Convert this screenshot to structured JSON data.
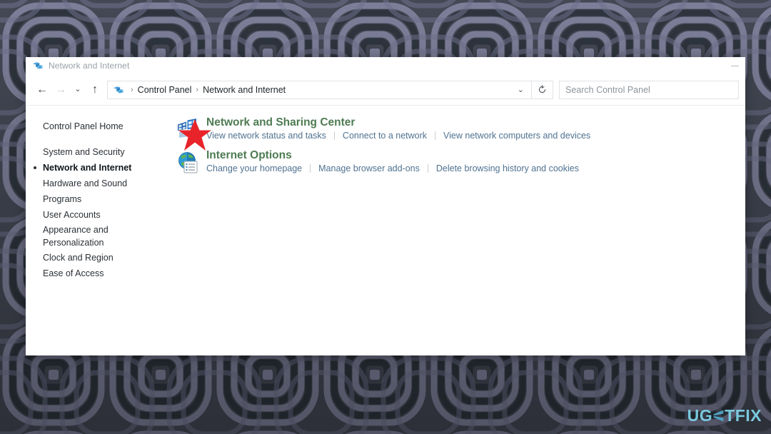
{
  "desktop": {
    "wallpaper_description": "concentric rounded-square maze pattern",
    "wallpaper_colors": {
      "base": "#46505c",
      "dark": "#2f3a42",
      "light": "#9a9ab8",
      "mid": "#6f7490"
    }
  },
  "window": {
    "title": "Network and Internet",
    "title_icon": "network-folder-icon",
    "controls": {
      "minimize_label": "—"
    }
  },
  "toolbar": {
    "back_label": "←",
    "forward_label": "→",
    "recent_label": "⌄",
    "up_label": "↑",
    "refresh_label": "↻",
    "address_icon": "network-folder-icon",
    "breadcrumbs": [
      "Control Panel",
      "Network and Internet"
    ],
    "breadcrumb_separator": "›",
    "dropdown_label": "⌄"
  },
  "search": {
    "placeholder": "Search Control Panel",
    "value": ""
  },
  "sidebar": {
    "items": [
      {
        "label": "Control Panel Home",
        "current": false,
        "group": "home"
      },
      {
        "label": "System and Security",
        "current": false
      },
      {
        "label": "Network and Internet",
        "current": true
      },
      {
        "label": "Hardware and Sound",
        "current": false
      },
      {
        "label": "Programs",
        "current": false
      },
      {
        "label": "User Accounts",
        "current": false
      },
      {
        "label": "Appearance and\nPersonalization",
        "current": false,
        "two_line": true
      },
      {
        "label": "Clock and Region",
        "current": false
      },
      {
        "label": "Ease of Access",
        "current": false
      }
    ]
  },
  "content": {
    "categories": [
      {
        "title": "Network and Sharing Center",
        "icon": "network-sharing-icon",
        "links": [
          "View network status and tasks",
          "Connect to a network",
          "View network computers and devices"
        ]
      },
      {
        "title": "Internet Options",
        "icon": "internet-options-globe-icon",
        "links": [
          "Change your homepage",
          "Manage browser add-ons",
          "Delete browsing history and cookies"
        ]
      }
    ]
  },
  "annotation": {
    "type": "red-star",
    "color": "#e8242a",
    "target": "Network and Sharing Center icon"
  },
  "watermark": {
    "text_before": "UG",
    "text_glyph": "E",
    "text_after": "TFIX",
    "color": "#7fd4ea"
  },
  "theme": {
    "heading_color": "#4e7b52",
    "link_color": "#4f7290",
    "text_color": "#2b3035",
    "title_color": "#9aa0a6",
    "window_bg": "#ffffff"
  }
}
